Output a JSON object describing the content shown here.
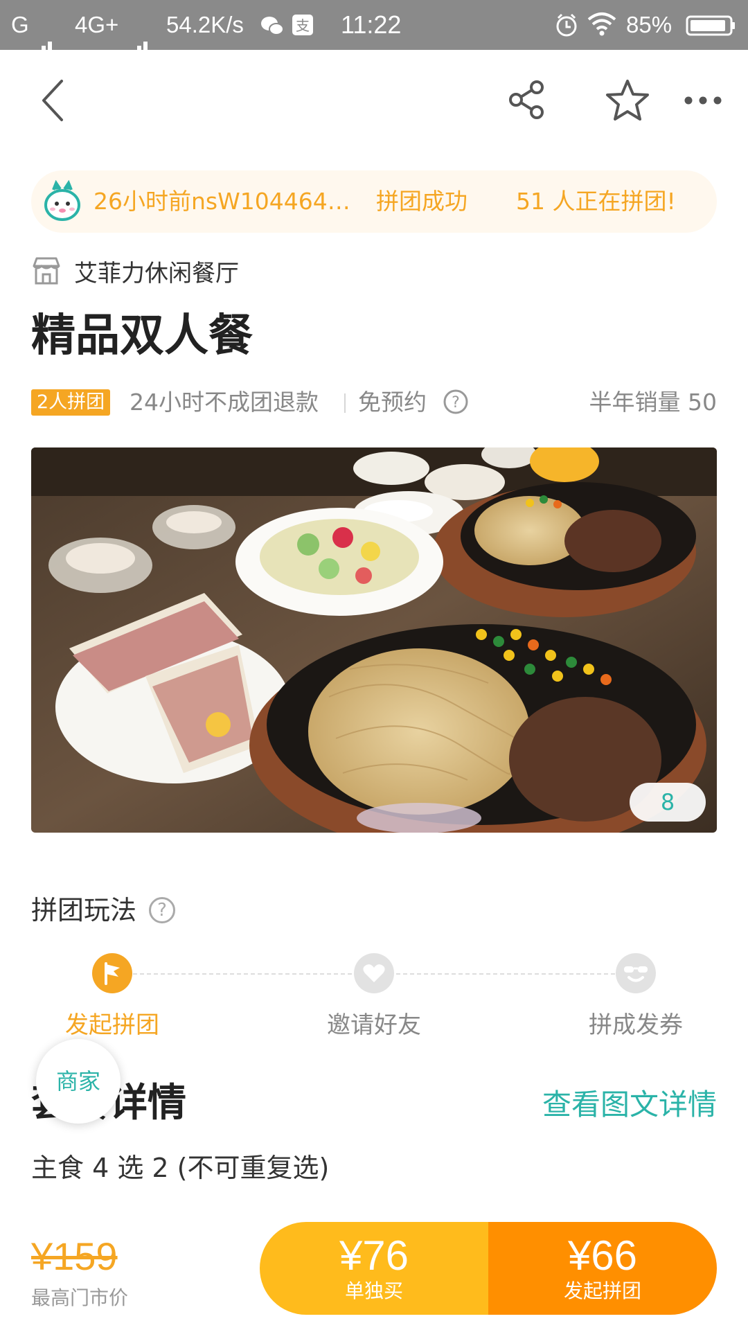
{
  "status_bar": {
    "carrier": "G",
    "network": "4G+",
    "speed": "54.2K/s",
    "time": "11:22",
    "battery": "85%"
  },
  "ticker": {
    "recent": "26小时前nsW104464…",
    "result": "拼团成功",
    "active": "51 人正在拼团!"
  },
  "shop": {
    "name": "艾菲力休闲餐厅"
  },
  "product": {
    "title": "精品双人餐",
    "badge": "2人拼团",
    "refund": "24小时不成团退款",
    "booking": "免预约",
    "sales": "半年销量 50",
    "photo_count": "8"
  },
  "how_to": {
    "title": "拼团玩法",
    "steps": [
      {
        "label": "发起拼团",
        "icon": "flag-icon",
        "active": true
      },
      {
        "label": "邀请好友",
        "icon": "heart-icon",
        "active": false
      },
      {
        "label": "拼成发券",
        "icon": "smile-sunglasses-icon",
        "active": false
      }
    ]
  },
  "merchant_bubble": "商家",
  "details": {
    "title": "套餐详情",
    "link": "查看图文详情",
    "subtitle": "主食 4 选 2 (不可重复选)"
  },
  "bottom_bar": {
    "original_price": "¥159",
    "original_label": "最高门市价",
    "solo_price": "¥76",
    "solo_label": "单独买",
    "group_price": "¥66",
    "group_label": "发起拼团"
  },
  "colors": {
    "accent_orange": "#f5a623",
    "teal": "#2bb3a8",
    "button_solo": "#ffbb1c",
    "button_group": "#ff8f00"
  }
}
